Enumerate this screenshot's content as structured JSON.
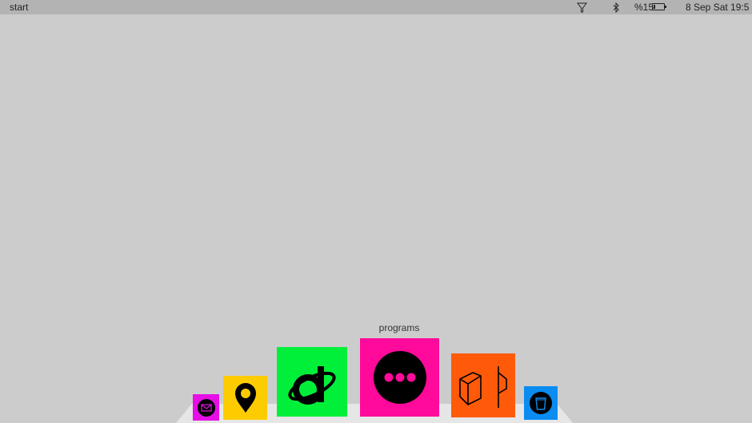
{
  "menubar": {
    "title": "start",
    "filter_icon": "filter-icon",
    "bluetooth_icon": "bluetooth-icon",
    "battery_text": "%15",
    "battery_level": 0.15,
    "clock": "8 Sep Sat 19:5"
  },
  "dock": {
    "hover_label": "programs",
    "items": [
      {
        "name": "mail",
        "icon": "mail-icon",
        "color": "#e60fe6"
      },
      {
        "name": "location",
        "icon": "location-pin-icon",
        "color": "#fccc00"
      },
      {
        "name": "browser",
        "icon": "browser-d-icon",
        "color": "#00f039"
      },
      {
        "name": "programs",
        "icon": "more-dots-icon",
        "color": "#ff0a9a"
      },
      {
        "name": "3d",
        "icon": "box-icon",
        "color": "#ff5a0a"
      },
      {
        "name": "trash",
        "icon": "trash-icon",
        "color": "#0a8cf0"
      }
    ]
  }
}
